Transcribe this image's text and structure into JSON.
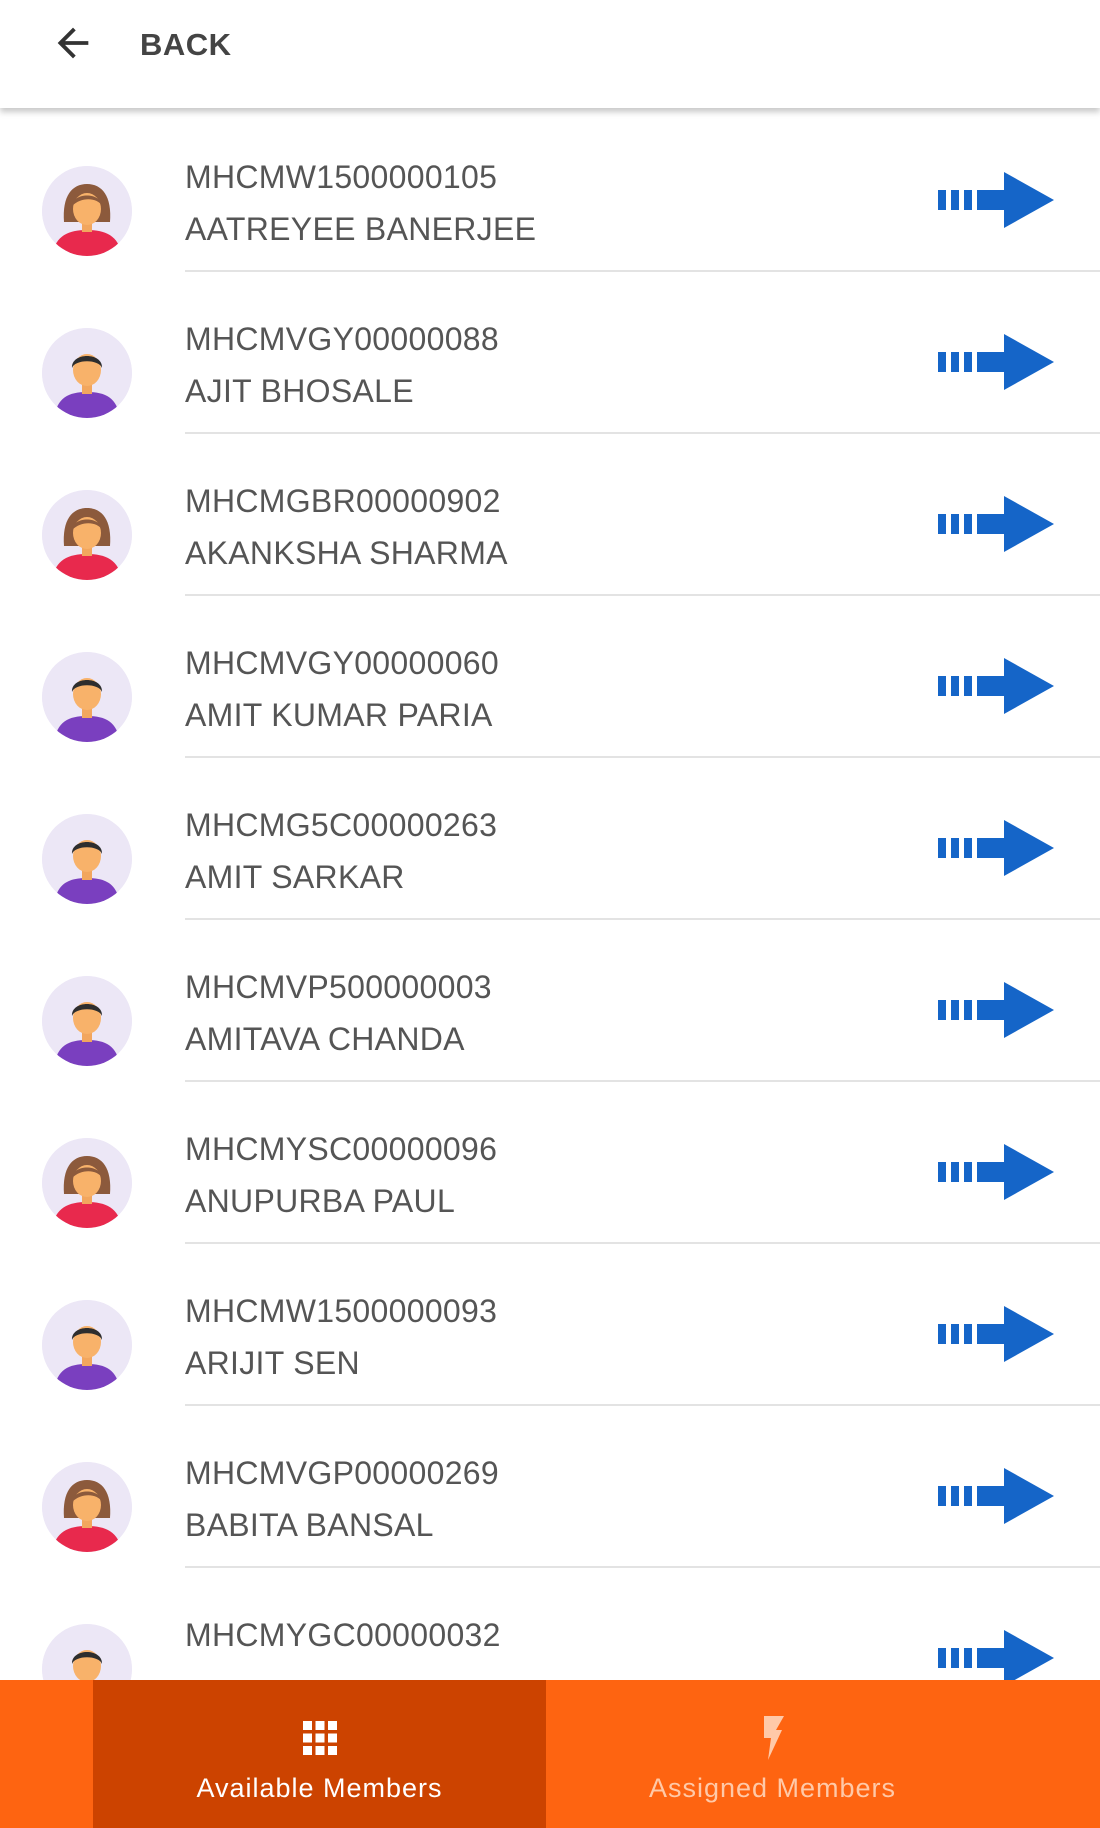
{
  "header": {
    "back_label": "BACK"
  },
  "members": [
    {
      "id": "MHCMW1500000105",
      "name": "AATREYEE BANERJEE",
      "avatar": "female"
    },
    {
      "id": "MHCMVGY00000088",
      "name": "AJIT BHOSALE",
      "avatar": "male"
    },
    {
      "id": "MHCMGBR00000902",
      "name": "AKANKSHA SHARMA",
      "avatar": "female"
    },
    {
      "id": "MHCMVGY00000060",
      "name": "AMIT KUMAR PARIA",
      "avatar": "male"
    },
    {
      "id": "MHCMG5C00000263",
      "name": "AMIT SARKAR",
      "avatar": "male"
    },
    {
      "id": "MHCMVP500000003",
      "name": "AMITAVA CHANDA",
      "avatar": "male"
    },
    {
      "id": "MHCMYSC00000096",
      "name": "ANUPURBA PAUL",
      "avatar": "female"
    },
    {
      "id": "MHCMW1500000093",
      "name": "ARIJIT SEN",
      "avatar": "male"
    },
    {
      "id": "MHCMVGP00000269",
      "name": "BABITA BANSAL",
      "avatar": "female"
    },
    {
      "id": "MHCMYGC00000032",
      "name": "",
      "avatar": "male"
    }
  ],
  "bottom_nav": {
    "tabs": [
      {
        "label": "Available Members",
        "icon": "grid-icon",
        "active": true
      },
      {
        "label": "Assigned Members",
        "icon": "bolt-icon",
        "active": false
      }
    ]
  },
  "colors": {
    "accent": "#fe6411",
    "accent_dark": "#cc4300",
    "arrow_blue": "#1565c8",
    "text": "#555555"
  }
}
